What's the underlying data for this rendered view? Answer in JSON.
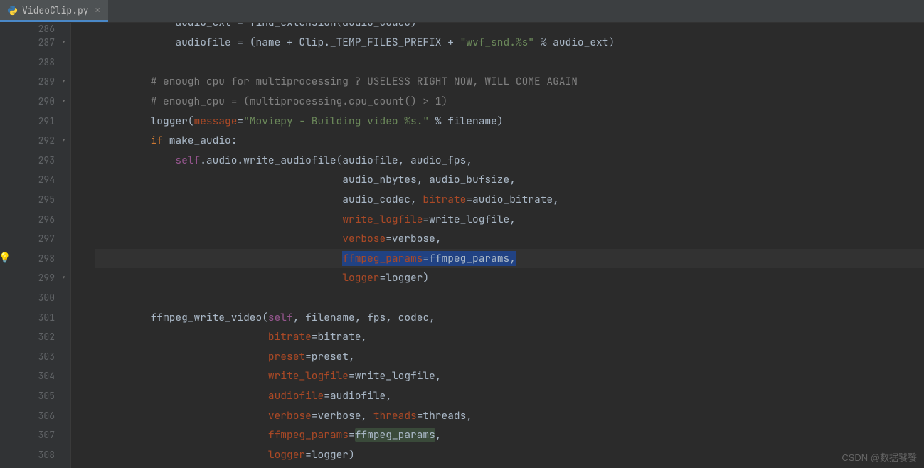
{
  "tab": {
    "filename": "VideoClip.py"
  },
  "watermark": "CSDN @数据饕餮",
  "highlight_row_index": 12,
  "gutter": [
    {
      "n": "286",
      "fold": ""
    },
    {
      "n": "287",
      "fold": "⊟"
    },
    {
      "n": "288",
      "fold": ""
    },
    {
      "n": "289",
      "fold": "⊟"
    },
    {
      "n": "290",
      "fold": "⊟"
    },
    {
      "n": "291",
      "fold": ""
    },
    {
      "n": "292",
      "fold": "⊟"
    },
    {
      "n": "293",
      "fold": ""
    },
    {
      "n": "294",
      "fold": ""
    },
    {
      "n": "295",
      "fold": ""
    },
    {
      "n": "296",
      "fold": ""
    },
    {
      "n": "297",
      "fold": ""
    },
    {
      "n": "298",
      "fold": "",
      "bulb": true
    },
    {
      "n": "299",
      "fold": "⊟"
    },
    {
      "n": "300",
      "fold": ""
    },
    {
      "n": "301",
      "fold": ""
    },
    {
      "n": "302",
      "fold": ""
    },
    {
      "n": "303",
      "fold": ""
    },
    {
      "n": "304",
      "fold": ""
    },
    {
      "n": "305",
      "fold": ""
    },
    {
      "n": "306",
      "fold": ""
    },
    {
      "n": "307",
      "fold": ""
    },
    {
      "n": "308",
      "fold": ""
    }
  ],
  "code": [
    [
      [
        "            audio_ext = find_extension(audio_codec)",
        "ident"
      ]
    ],
    [
      [
        "            audiofile = (name + Clip._TEMP_FILES_PREFIX + ",
        "ident"
      ],
      [
        "\"wvf_snd.%s\"",
        "str"
      ],
      [
        " % audio_ext)",
        "ident"
      ]
    ],
    [
      [
        "",
        "ident"
      ]
    ],
    [
      [
        "        ",
        "ident"
      ],
      [
        "# enough cpu for multiprocessing ? USELESS RIGHT NOW, WILL COME AGAIN",
        "cmt"
      ]
    ],
    [
      [
        "        ",
        "ident"
      ],
      [
        "# enough_cpu = (multiprocessing.cpu_count() > 1)",
        "cmt"
      ]
    ],
    [
      [
        "        logger(",
        "ident"
      ],
      [
        "message",
        "param"
      ],
      [
        "=",
        "ident"
      ],
      [
        "\"Moviepy - Building video %s.\"",
        "str"
      ],
      [
        " % filename)",
        "ident"
      ]
    ],
    [
      [
        "        ",
        "ident"
      ],
      [
        "if",
        "kw"
      ],
      [
        " make_audio:",
        "ident"
      ]
    ],
    [
      [
        "            ",
        "ident"
      ],
      [
        "self",
        "self"
      ],
      [
        ".audio.write_audiofile(audiofile",
        "ident"
      ],
      [
        ",",
        "punct"
      ],
      [
        " audio_fps",
        "ident"
      ],
      [
        ",",
        "punct"
      ]
    ],
    [
      [
        "                                       audio_nbytes",
        "ident"
      ],
      [
        ",",
        "punct"
      ],
      [
        " audio_bufsize",
        "ident"
      ],
      [
        ",",
        "punct"
      ]
    ],
    [
      [
        "                                       audio_codec",
        "ident"
      ],
      [
        ",",
        "punct"
      ],
      [
        " ",
        "ident"
      ],
      [
        "bitrate",
        "param"
      ],
      [
        "=audio_bitrate",
        "ident"
      ],
      [
        ",",
        "punct"
      ]
    ],
    [
      [
        "                                       ",
        "ident"
      ],
      [
        "write_logfile",
        "param"
      ],
      [
        "=write_logfile",
        "ident"
      ],
      [
        ",",
        "punct"
      ]
    ],
    [
      [
        "                                       ",
        "ident"
      ],
      [
        "verbose",
        "param"
      ],
      [
        "=verbose",
        "ident"
      ],
      [
        ",",
        "punct"
      ]
    ],
    [
      [
        "                                       ",
        "ident"
      ],
      [
        "__CARET__",
        "caret"
      ],
      [
        "ffmpeg_params",
        "param-sel"
      ],
      [
        "=ffmpeg_params",
        "ident-sel"
      ],
      [
        ",",
        "punct-sel"
      ]
    ],
    [
      [
        "                                       ",
        "ident"
      ],
      [
        "logger",
        "param"
      ],
      [
        "=logger)",
        "ident"
      ]
    ],
    [
      [
        "",
        "ident"
      ]
    ],
    [
      [
        "        ffmpeg_write_video(",
        "ident"
      ],
      [
        "self",
        "self"
      ],
      [
        ",",
        "punct"
      ],
      [
        " filename",
        "ident"
      ],
      [
        ",",
        "punct"
      ],
      [
        " fps",
        "ident"
      ],
      [
        ",",
        "punct"
      ],
      [
        " codec",
        "ident"
      ],
      [
        ",",
        "punct"
      ]
    ],
    [
      [
        "                           ",
        "ident"
      ],
      [
        "bitrate",
        "param"
      ],
      [
        "=bitrate",
        "ident"
      ],
      [
        ",",
        "punct"
      ]
    ],
    [
      [
        "                           ",
        "ident"
      ],
      [
        "preset",
        "param"
      ],
      [
        "=preset",
        "ident"
      ],
      [
        ",",
        "punct"
      ]
    ],
    [
      [
        "                           ",
        "ident"
      ],
      [
        "write_logfile",
        "param"
      ],
      [
        "=write_logfile",
        "ident"
      ],
      [
        ",",
        "punct"
      ]
    ],
    [
      [
        "                           ",
        "ident"
      ],
      [
        "audiofile",
        "param"
      ],
      [
        "=audiofile",
        "ident"
      ],
      [
        ",",
        "punct"
      ]
    ],
    [
      [
        "                           ",
        "ident"
      ],
      [
        "verbose",
        "param"
      ],
      [
        "=verbose",
        "ident"
      ],
      [
        ",",
        "punct"
      ],
      [
        " ",
        "ident"
      ],
      [
        "threads",
        "param"
      ],
      [
        "=threads",
        "ident"
      ],
      [
        ",",
        "punct"
      ]
    ],
    [
      [
        "                           ",
        "ident"
      ],
      [
        "ffmpeg_params",
        "param"
      ],
      [
        "=",
        "ident"
      ],
      [
        "ffmpeg_params",
        "usage"
      ],
      [
        ",",
        "punct"
      ]
    ],
    [
      [
        "                           ",
        "ident"
      ],
      [
        "logger",
        "param"
      ],
      [
        "=logger)",
        "ident"
      ]
    ]
  ]
}
